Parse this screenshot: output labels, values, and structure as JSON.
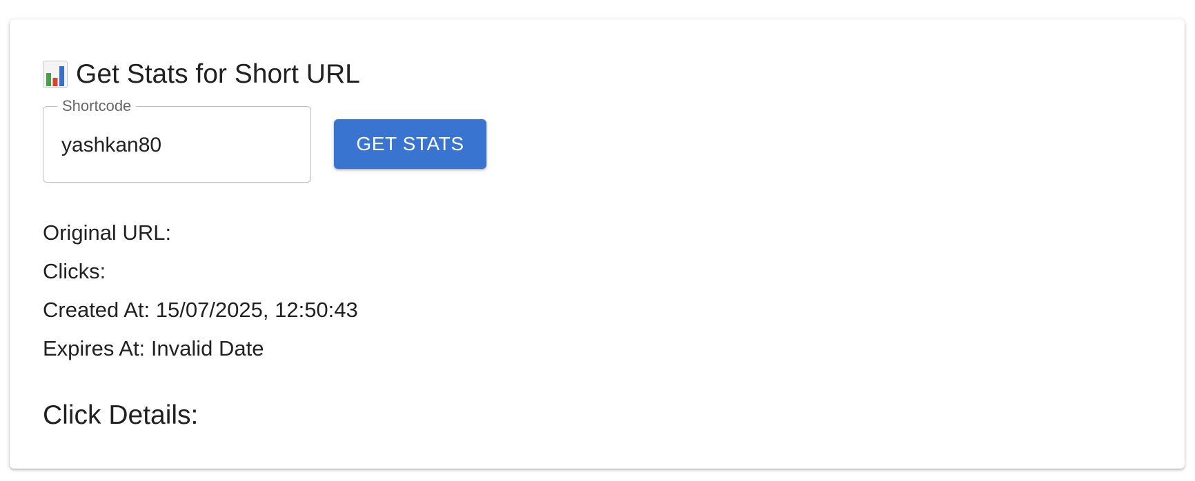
{
  "card": {
    "title_icon": "bar-chart-icon",
    "title": "Get Stats for Short URL"
  },
  "shortcode_field": {
    "label": "Shortcode",
    "value": "yashkan80"
  },
  "get_stats_button": {
    "label": "GET STATS",
    "color": "#3a74d1"
  },
  "stats": {
    "original_url": {
      "label": "Original URL:",
      "value": ""
    },
    "clicks": {
      "label": "Clicks:",
      "value": ""
    },
    "created_at": {
      "label": "Created At:",
      "value": "15/07/2025, 12:50:43"
    },
    "expires_at": {
      "label": "Expires At:",
      "value": "Invalid Date"
    }
  },
  "click_details": {
    "heading": "Click Details:"
  }
}
